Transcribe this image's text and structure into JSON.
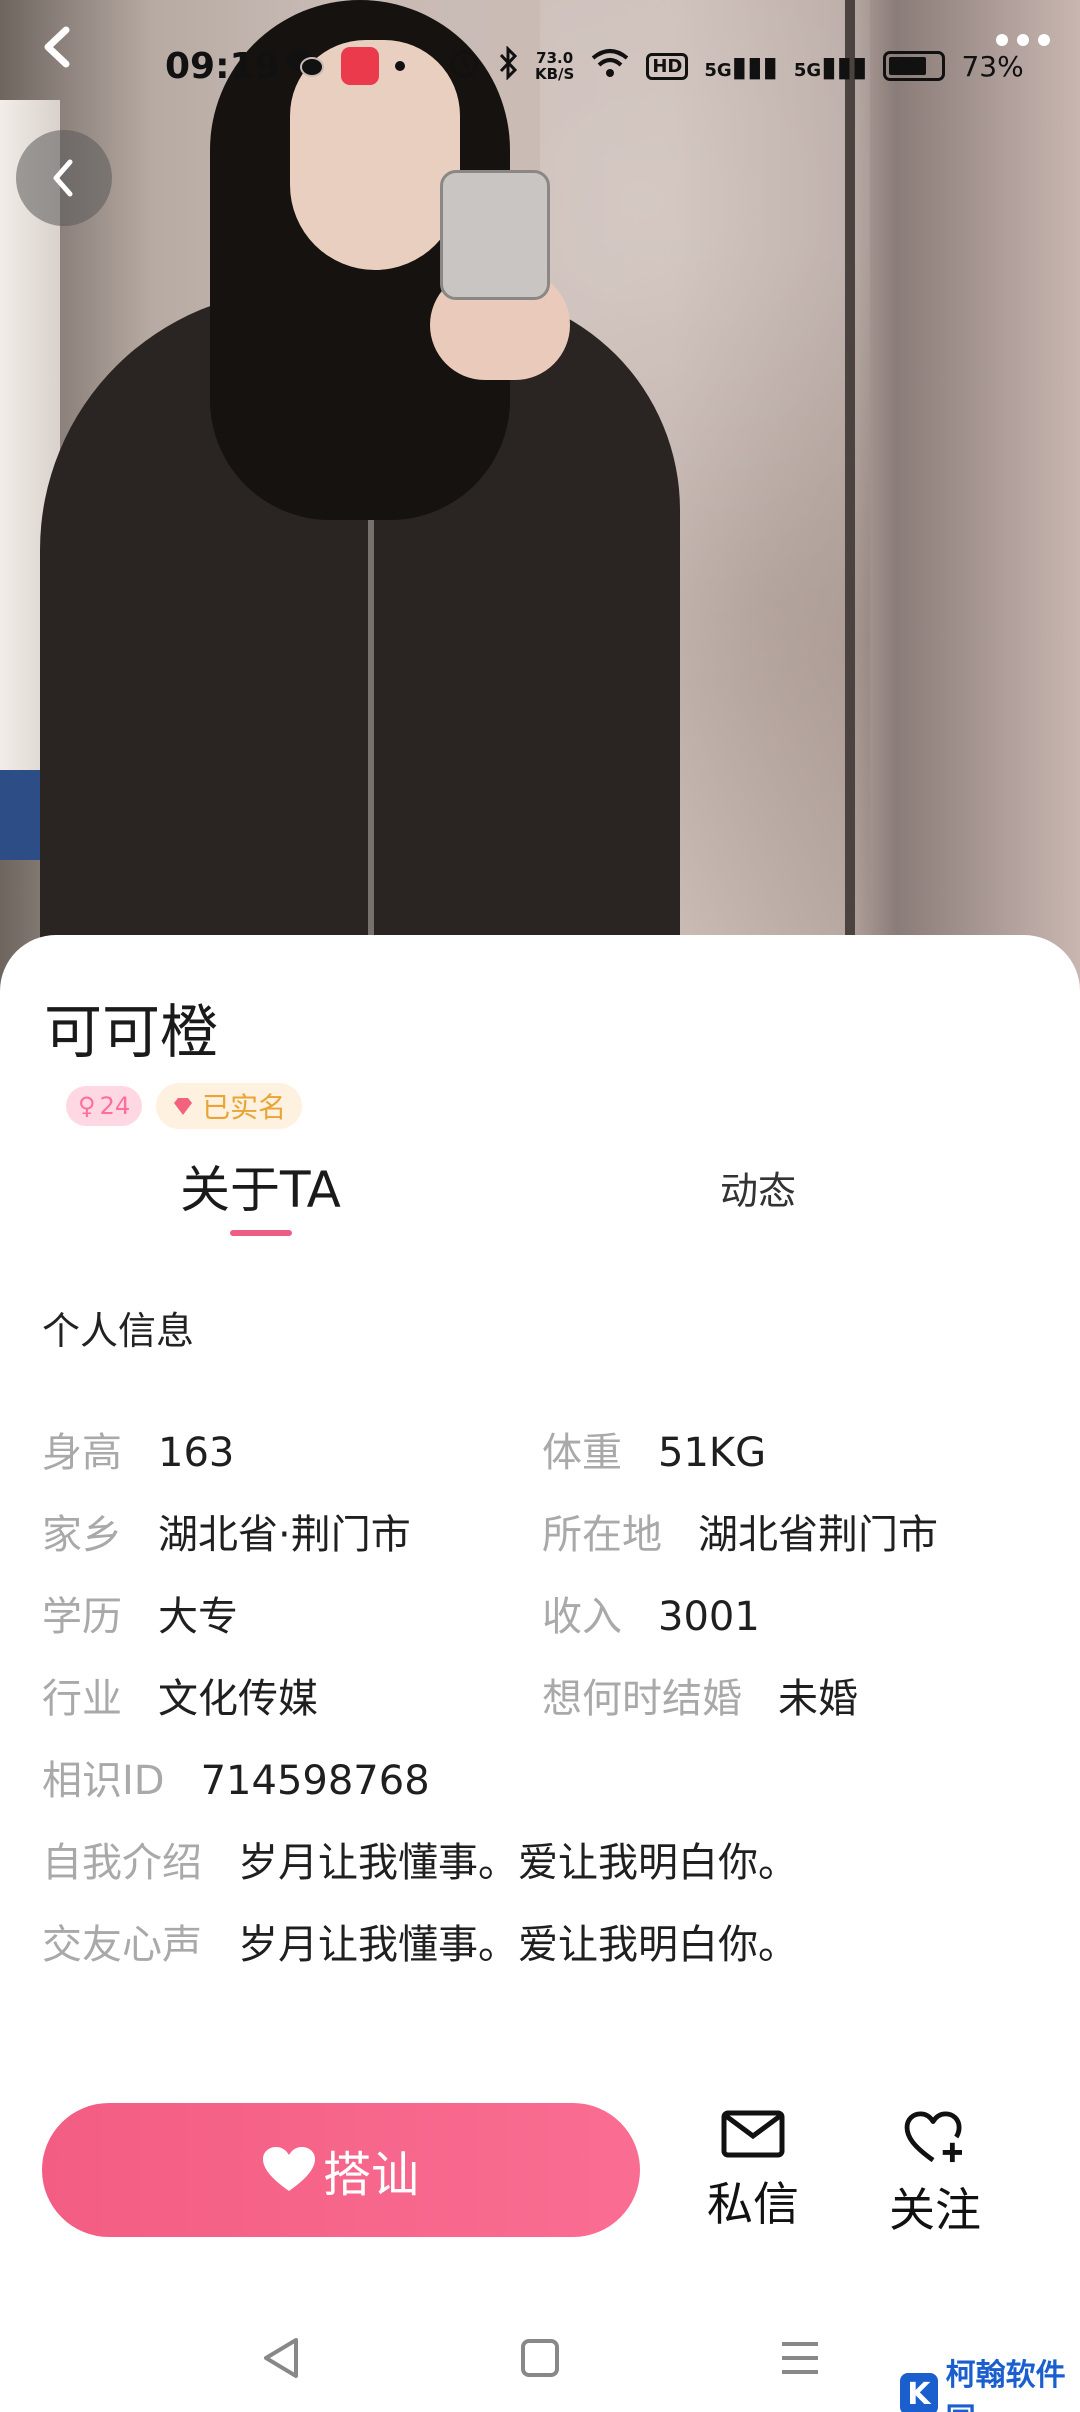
{
  "status_bar": {
    "time": "09:19",
    "net_speed_value": "73.0",
    "net_speed_unit": "KB/S",
    "hd": "HD",
    "signal_1": "5G",
    "signal_2": "5G",
    "battery_percent": "73%",
    "battery_level": 0.73
  },
  "profile": {
    "nickname": "可可橙",
    "age": "24",
    "age_symbol": "♀",
    "verified_label": "已实名"
  },
  "tabs": [
    {
      "label": "关于TA",
      "active": true
    },
    {
      "label": "动态",
      "active": false
    }
  ],
  "section_title": "个人信息",
  "info": {
    "height_label": "身高",
    "height_value": "163",
    "weight_label": "体重",
    "weight_value": "51KG",
    "hometown_label": "家乡",
    "hometown_value": "湖北省·荆门市",
    "location_label": "所在地",
    "location_value": "湖北省荆门市",
    "education_label": "学历",
    "education_value": "大专",
    "income_label": "收入",
    "income_value": "3001",
    "industry_label": "行业",
    "industry_value": "文化传媒",
    "marriage_label": "想何时结婚",
    "marriage_value": "未婚",
    "id_label": "相识ID",
    "id_value": "714598768",
    "intro_label": "自我介绍",
    "intro_value": "岁月让我懂事。爱让我明白你。",
    "voice_label": "交友心声",
    "voice_value": "岁月让我懂事。爱让我明白你。"
  },
  "actions": {
    "greet_label": "搭讪",
    "message_label": "私信",
    "follow_label": "关注"
  },
  "watermark": {
    "logo_letter": "K",
    "text": "柯翰软件园"
  },
  "colors": {
    "accent_pink": "#f35d83",
    "verified_gold": "#e8a535",
    "label_gray": "#a9a9a9"
  }
}
